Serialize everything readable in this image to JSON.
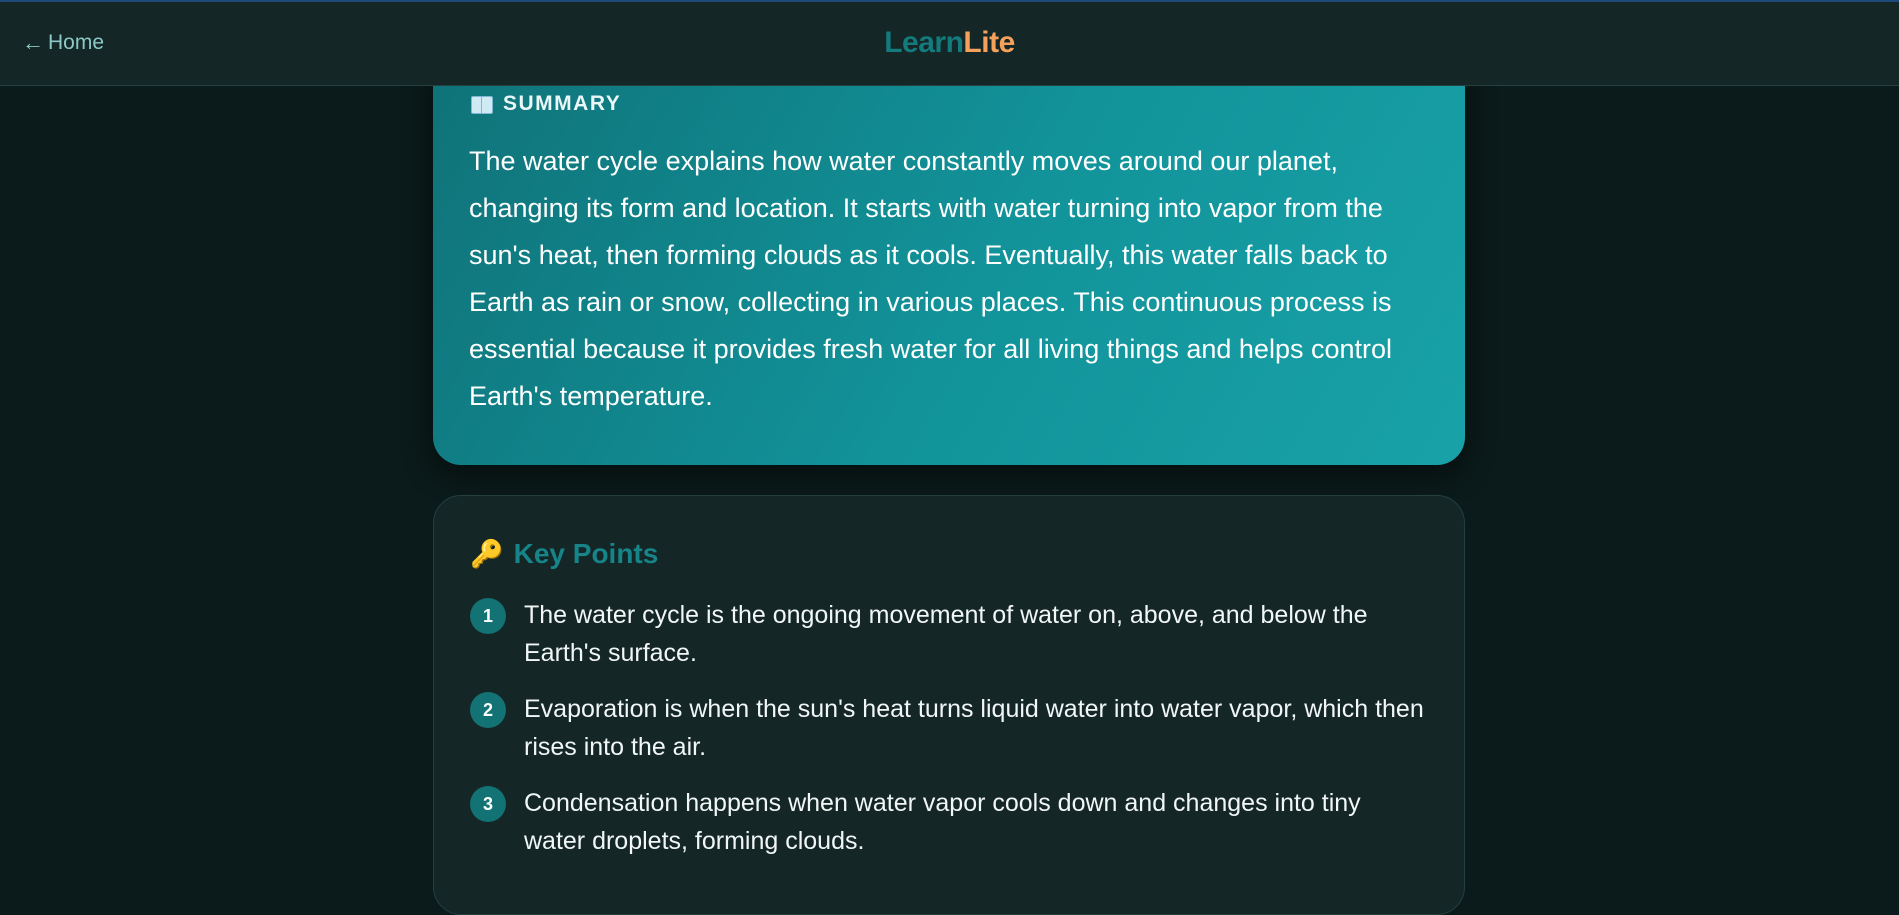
{
  "header": {
    "home_label": "Home",
    "home_arrow": "←",
    "logo_part1": "Learn",
    "logo_part2": "Lite"
  },
  "summary": {
    "icon": "book-icon",
    "heading": "SUMMARY",
    "text": "The water cycle explains how water constantly moves around our planet, changing its form and location. It starts with water turning into vapor from the sun's heat, then forming clouds as it cools. Eventually, this water falls back to Earth as rain or snow, collecting in various places. This continuous process is essential because it provides fresh water for all living things and helps control Earth's temperature."
  },
  "key_points": {
    "icon": "key-icon",
    "heading": "Key Points",
    "items": [
      {
        "number": "1",
        "text": "The water cycle is the ongoing movement of water on, above, and below the Earth's surface."
      },
      {
        "number": "2",
        "text": "Evaporation is when the sun's heat turns liquid water into water vapor, which then rises into the air."
      },
      {
        "number": "3",
        "text": "Condensation happens when water vapor cools down and changes into tiny water droplets, forming clouds."
      }
    ]
  },
  "colors": {
    "background": "#0b1a1a",
    "header_bg": "#142626",
    "accent_teal": "#137a7d",
    "accent_orange": "#f4a25b",
    "summary_gradient_start": "#0f7278",
    "summary_gradient_end": "#18a2a8"
  }
}
